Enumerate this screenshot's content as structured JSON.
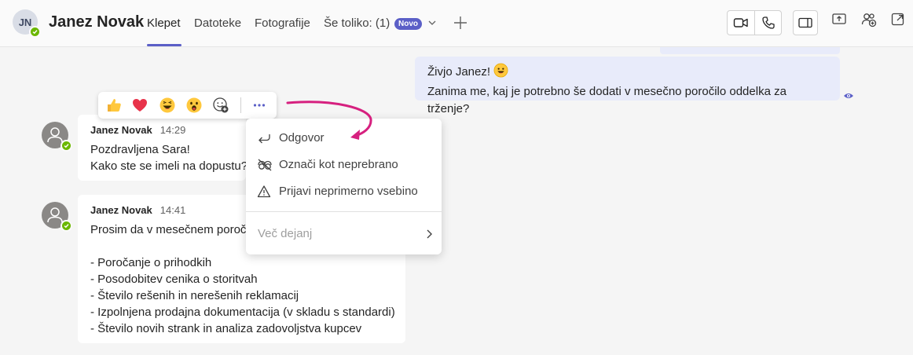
{
  "header": {
    "avatar_initials": "JN",
    "contact_name": "Janez Novak",
    "tabs": [
      {
        "label": "Klepet",
        "active": true
      },
      {
        "label": "Datoteke",
        "active": false
      },
      {
        "label": "Fotografije",
        "active": false
      },
      {
        "label": "Še toliko: (1)",
        "active": false
      }
    ],
    "badge": "Novo",
    "icons": [
      "video-call-icon",
      "audio-call-icon",
      "panel-icon",
      "share-screen-icon",
      "add-people-icon",
      "pop-out-icon"
    ],
    "accent_color": "#5b5fc7",
    "presence_color": "#6bb700"
  },
  "sent_message": {
    "lines": [
      "Živjo Janez!",
      "Zanima me, kaj je potrebno še dodati v mesečno poročilo oddelka za trženje?"
    ],
    "emoji": "grinning-face-emoji",
    "bubble_color": "#e8ebfa"
  },
  "messages": [
    {
      "author": "Janez Novak",
      "time": "14:29",
      "lines": [
        "Pozdravljena Sara!",
        "Kako ste se imeli na dopustu?"
      ]
    },
    {
      "author": "Janez Novak",
      "time": "14:41",
      "lines": [
        "Prosim da v mesečnem poroči",
        "",
        "- Poročanje o prihodkih",
        "- Posodobitev cenika o storitvah",
        "- Število rešenih in nerešenih reklamacij",
        "- Izpolnjena prodajna dokumentacija (v skladu s standardi)",
        "- Število novih strank in analiza zadovoljstva kupcev"
      ]
    }
  ],
  "reactions": [
    "thumbs-up-emoji",
    "heart-emoji",
    "laughing-emoji",
    "surprised-emoji",
    "add-reaction-icon"
  ],
  "context_menu": {
    "items": [
      {
        "label": "Odgovor",
        "icon": "reply-icon"
      },
      {
        "label": "Označi kot neprebrano",
        "icon": "mark-unread-icon"
      },
      {
        "label": "Prijavi neprimerno vsebino",
        "icon": "warning-icon"
      }
    ],
    "more_actions": "Več dejanj"
  },
  "annotation_color": "#d6207f"
}
